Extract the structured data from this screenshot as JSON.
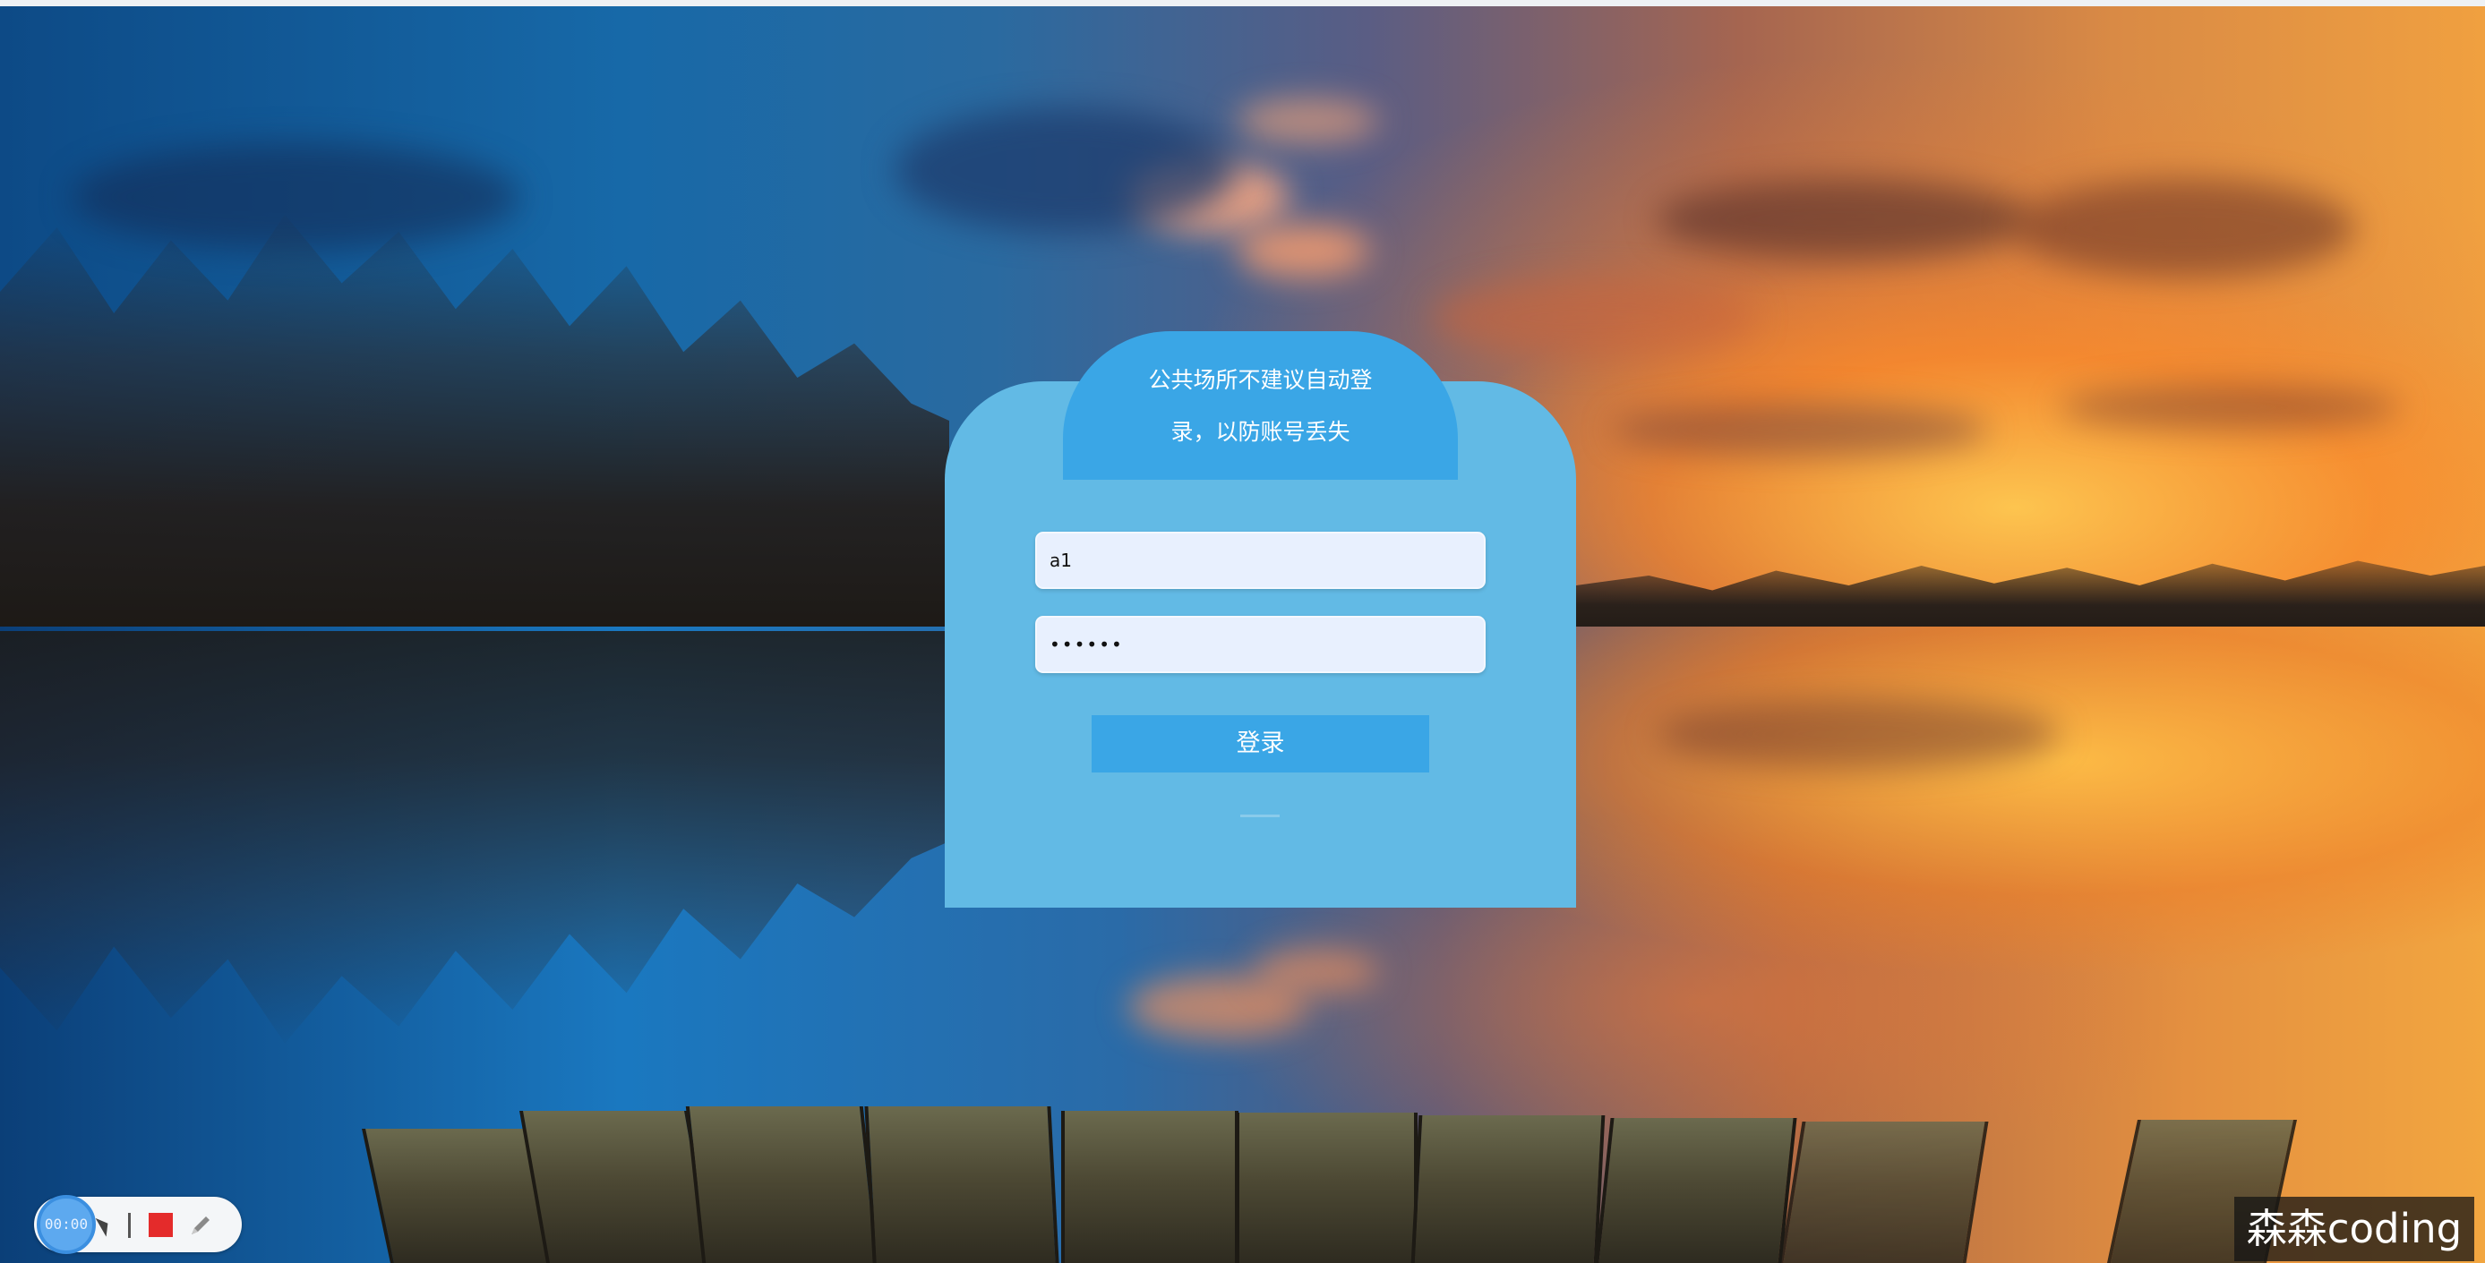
{
  "login": {
    "tip_line1": "公共场所不建议自动登",
    "tip_line2": "录，以防账号丢失",
    "username_value": "a1",
    "password_value": "••••••",
    "login_button_label": "登录"
  },
  "recorder": {
    "timer": "00:00",
    "icons": [
      "cursor-icon",
      "separator",
      "stop-icon",
      "pen-icon"
    ]
  },
  "watermark": {
    "text": "森森coding"
  },
  "colors": {
    "card": "#62bae5",
    "accent": "#3aa6e6",
    "input_bg": "#e8f0fe",
    "stop_red": "#e42b2b"
  }
}
